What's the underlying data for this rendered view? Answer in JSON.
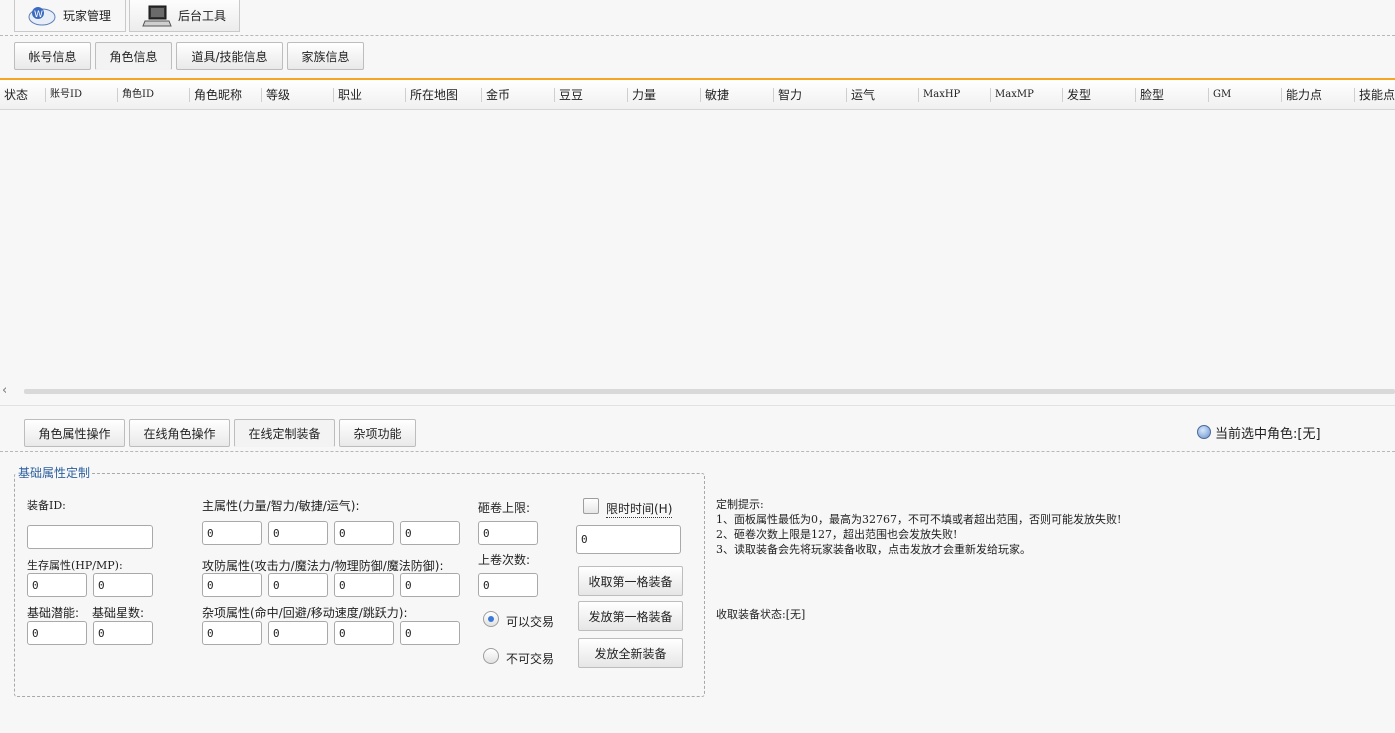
{
  "top_tabs": [
    {
      "label": "玩家管理",
      "icon": "player-manage-icon"
    },
    {
      "label": "后台工具",
      "icon": "computer-icon"
    }
  ],
  "sub_tabs": [
    {
      "label": "帐号信息"
    },
    {
      "label": "角色信息"
    },
    {
      "label": "道具/技能信息"
    },
    {
      "label": "家族信息"
    }
  ],
  "grid": {
    "columns": [
      "状态",
      "账号ID",
      "角色ID",
      "角色昵称",
      "等级",
      "职业",
      "所在地图",
      "金币",
      "豆豆",
      "力量",
      "敏捷",
      "智力",
      "运气",
      "MaxHP",
      "MaxMP",
      "发型",
      "脸型",
      "GM",
      "能力点",
      "技能点"
    ],
    "rows": []
  },
  "lower_tabs": [
    {
      "label": "角色属性操作"
    },
    {
      "label": "在线角色操作"
    },
    {
      "label": "在线定制装备"
    },
    {
      "label": "杂项功能"
    }
  ],
  "current_role": "当前选中角色:[无]",
  "form": {
    "legend": "基础属性定制",
    "equip_id_label": "装备ID:",
    "equip_id_value": "",
    "survival_label": "生存属性(HP/MP):",
    "survival_values": [
      "0",
      "0"
    ],
    "base_potential_label": "基础潜能:",
    "base_potential_value": "0",
    "base_star_label": "基础星数:",
    "base_star_value": "0",
    "main_attr_label": "主属性(力量/智力/敏捷/运气):",
    "main_attr_values": [
      "0",
      "0",
      "0",
      "0"
    ],
    "atk_def_label": "攻防属性(攻击力/魔法力/物理防御/魔法防御):",
    "atk_def_values": [
      "0",
      "0",
      "0",
      "0"
    ],
    "misc_attr_label": "杂项属性(命中/回避/移动速度/跳跃力):",
    "misc_attr_values": [
      "0",
      "0",
      "0",
      "0"
    ],
    "scroll_limit_label": "砸卷上限:",
    "scroll_limit_value": "0",
    "scroll_count_label": "上卷次数:",
    "scroll_count_value": "0",
    "tradable_label": "可以交易",
    "untradable_label": "不可交易",
    "time_limit_label": "限时时间(H)",
    "time_limit_value": "0",
    "btn_take_first": "收取第一格装备",
    "btn_send_first": "发放第一格装备",
    "btn_send_new": "发放全新装备"
  },
  "tips": {
    "title": "定制提示:",
    "lines": [
      "1、面板属性最低为0，最高为32767，不可不填或者超出范围，否则可能发放失败!",
      "2、砸卷次数上限是127，超出范围也会发放失败!",
      "3、读取装备会先将玩家装备收取，点击发放才会重新发给玩家。"
    ]
  },
  "receive_status": "收取装备状态:[无]"
}
